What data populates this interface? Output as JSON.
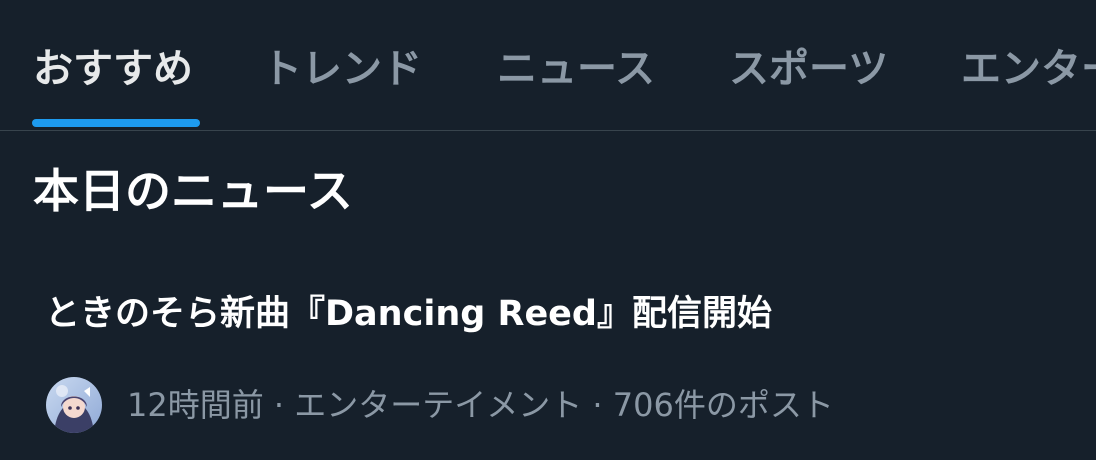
{
  "tabs": [
    {
      "label": "おすすめ",
      "active": true
    },
    {
      "label": "トレンド",
      "active": false
    },
    {
      "label": "ニュース",
      "active": false
    },
    {
      "label": "スポーツ",
      "active": false
    },
    {
      "label": "エンターテイメント",
      "active": false
    }
  ],
  "section": {
    "title": "本日のニュース"
  },
  "news": [
    {
      "headline": "ときのそら新曲『Dancing Reed』配信開始",
      "meta": "12時間前 · エンターテイメント · 706件のポスト",
      "avatar_icon": "avatar-image"
    }
  ],
  "colors": {
    "background": "#16202b",
    "accent": "#1d9bf0",
    "text_primary": "#e7e9ea",
    "text_secondary": "#8b98a5",
    "divider": "#38444d"
  }
}
